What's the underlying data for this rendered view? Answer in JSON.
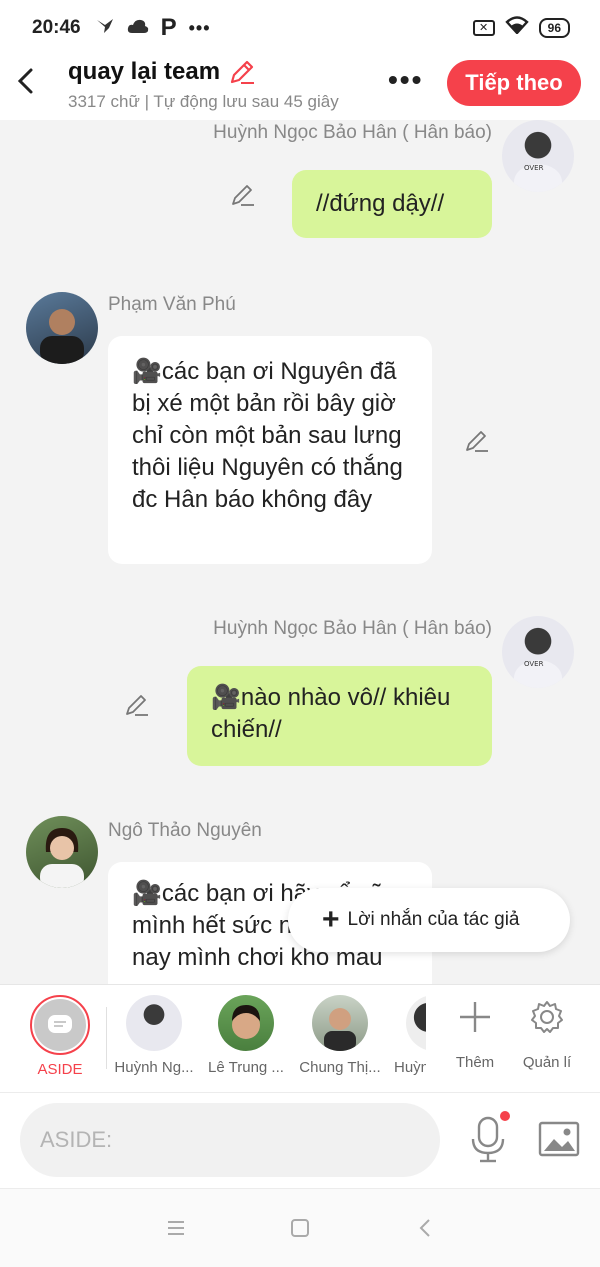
{
  "status": {
    "time": "20:46",
    "battery": "96",
    "icons": [
      "bird-icon",
      "cloud-icon",
      "p-app-icon",
      "more-icon",
      "sim-off-icon",
      "wifi-icon",
      "battery-icon"
    ]
  },
  "header": {
    "title": "quay lại team",
    "subtitle": "3317 chữ | Tự động lưu sau 45 giây",
    "more": "•••",
    "next_label": "Tiếp theo"
  },
  "colors": {
    "accent": "#f5414b",
    "bubble_right": "#d8f59a",
    "bubble_left": "#ffffff",
    "background": "#f3f3f3"
  },
  "messages": [
    {
      "side": "right",
      "name": "Huỳnh Ngọc Bảo Hân ( Hân báo)",
      "text": "//đứng dậy//"
    },
    {
      "side": "left",
      "name": "Phạm Văn Phú",
      "text": "🎥các bạn ơi Nguyên đã bị xé một bản rồi bây giờ chỉ còn một bản sau lưng thôi liệu Nguyên có thắng đc Hân báo không đây"
    },
    {
      "side": "right",
      "name": "Huỳnh Ngọc Bảo Hân ( Hân báo)",
      "text": "🎥nào nhào vô// khiêu chiến//"
    },
    {
      "side": "left",
      "name": "Ngô Thảo Nguyên",
      "text": "🎥các bạn ơi hãy cổ vũ mình hết sức nhé hôm nay mình chơi khô máu"
    }
  ],
  "author_note": {
    "plus": "+",
    "label": "Lời nhắn của tác giả"
  },
  "characters": [
    {
      "label": "ASIDE"
    },
    {
      "label": "Huỳnh Ng..."
    },
    {
      "label": "Lê Trung ..."
    },
    {
      "label": "Chung Thị..."
    },
    {
      "label": "Huỳnh"
    }
  ],
  "tools": {
    "add_label": "Thêm",
    "manage_label": "Quản lí"
  },
  "input": {
    "placeholder": "ASIDE:"
  }
}
